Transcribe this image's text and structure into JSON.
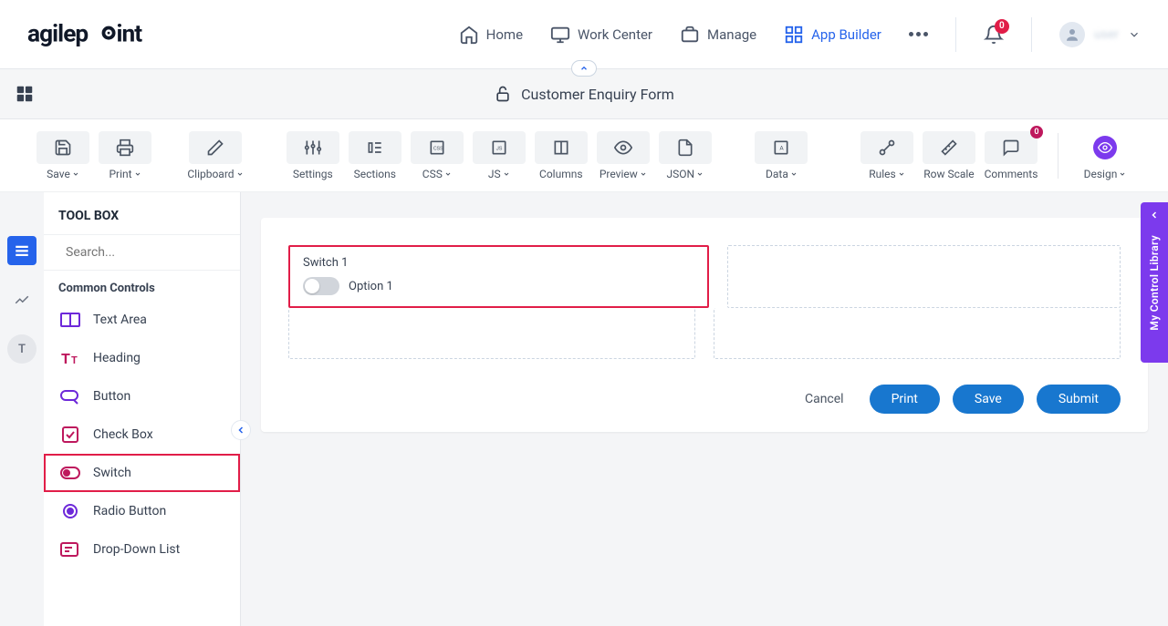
{
  "header": {
    "nav": {
      "home": "Home",
      "work_center": "Work Center",
      "manage": "Manage",
      "app_builder": "App Builder"
    },
    "notifications_count": "0",
    "user_name": "user"
  },
  "title_bar": {
    "title": "Customer Enquiry Form"
  },
  "toolbar": {
    "save": "Save",
    "print": "Print",
    "clipboard": "Clipboard",
    "settings": "Settings",
    "sections": "Sections",
    "css": "CSS",
    "js": "JS",
    "columns": "Columns",
    "preview": "Preview",
    "json": "JSON",
    "data": "Data",
    "rules": "Rules",
    "row_scale": "Row Scale",
    "comments": "Comments",
    "comments_count": "0",
    "design": "Design"
  },
  "sidebar": {
    "title": "TOOL BOX",
    "search_placeholder": "Search...",
    "group": "Common Controls",
    "controls": {
      "text_area": "Text Area",
      "heading": "Heading",
      "button": "Button",
      "check_box": "Check Box",
      "switch": "Switch",
      "radio_button": "Radio Button",
      "drop_down_list": "Drop-Down List"
    }
  },
  "canvas": {
    "field_label": "Switch 1",
    "option_label": "Option 1",
    "actions": {
      "cancel": "Cancel",
      "print": "Print",
      "save": "Save",
      "submit": "Submit"
    }
  },
  "side_panel": {
    "label": "My Control Library"
  }
}
